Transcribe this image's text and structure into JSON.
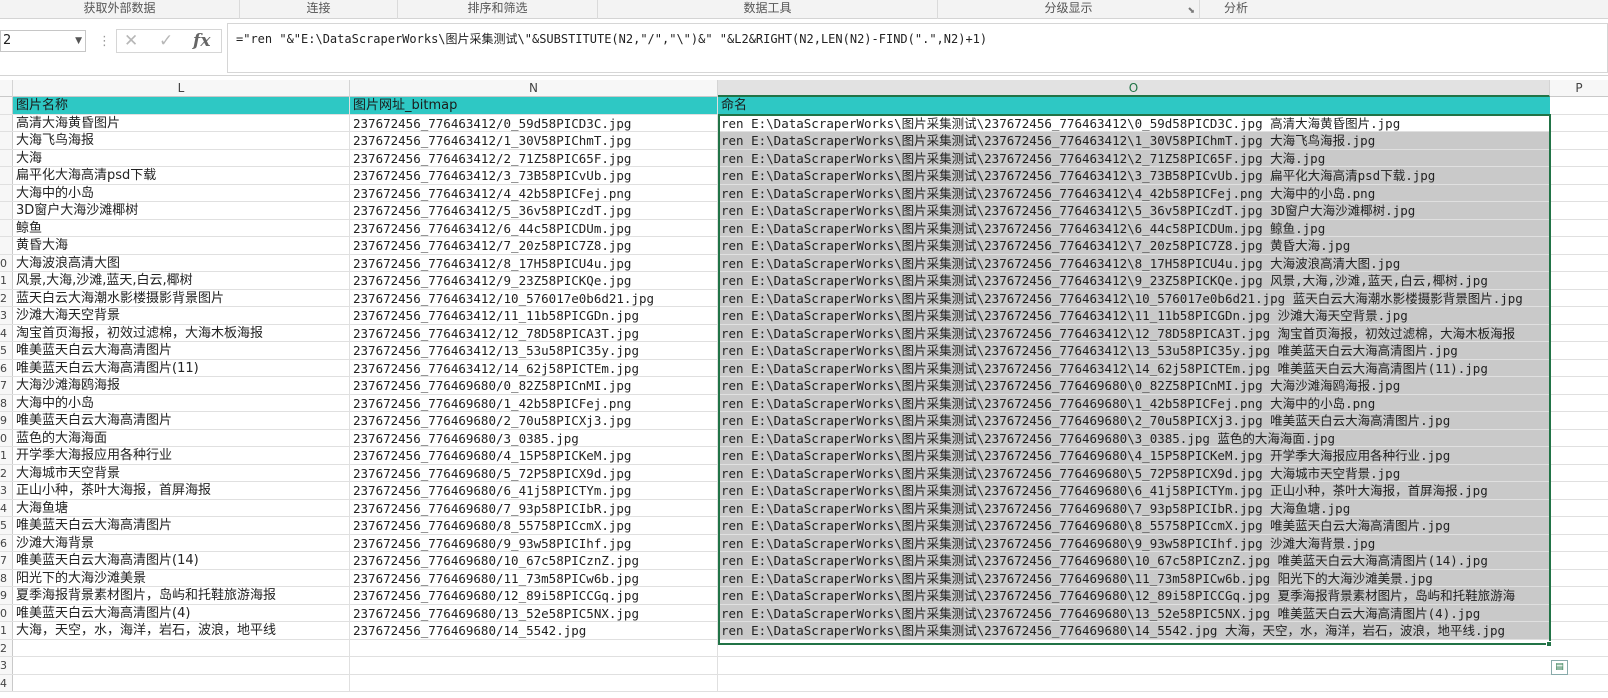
{
  "ribbon": {
    "groups": [
      {
        "label": "获取外部数据"
      },
      {
        "label": "连接"
      },
      {
        "label": "排序和筛选"
      },
      {
        "label": "数据工具"
      },
      {
        "label": "分级显示"
      },
      {
        "label": "分析"
      }
    ]
  },
  "formula_bar": {
    "name_box": "2",
    "formula": "=\"ren \"&\"E:\\DataScraperWorks\\图片采集测试\\\"&SUBSTITUTE(N2,\"/\",\"\\\")&\" \"&L2&RIGHT(N2,LEN(N2)-FIND(\".\",N2)+1)"
  },
  "columns": [
    {
      "label": "L",
      "active": false
    },
    {
      "label": "N",
      "active": false
    },
    {
      "label": "O",
      "active": true
    },
    {
      "label": "P",
      "active": false
    }
  ],
  "header_row": {
    "L": "图片名称",
    "N": "图片网址_bitmap",
    "O": "命名"
  },
  "rows": [
    {
      "num": "",
      "L": "高清大海黄昏图片",
      "N": "237672456_776463412/0_59d58PICD3C.jpg",
      "O": "ren E:\\DataScraperWorks\\图片采集测试\\237672456_776463412\\0_59d58PICD3C.jpg 高清大海黄昏图片.jpg"
    },
    {
      "num": "",
      "L": "大海飞鸟海报",
      "N": "237672456_776463412/1_30V58PIChmT.jpg",
      "O": "ren E:\\DataScraperWorks\\图片采集测试\\237672456_776463412\\1_30V58PIChmT.jpg 大海飞鸟海报.jpg"
    },
    {
      "num": "",
      "L": "大海",
      "N": "237672456_776463412/2_71Z58PIC65F.jpg",
      "O": "ren E:\\DataScraperWorks\\图片采集测试\\237672456_776463412\\2_71Z58PIC65F.jpg 大海.jpg"
    },
    {
      "num": "",
      "L": "扁平化大海高清psd下载",
      "N": "237672456_776463412/3_73B58PICvUb.jpg",
      "O": "ren E:\\DataScraperWorks\\图片采集测试\\237672456_776463412\\3_73B58PICvUb.jpg 扁平化大海高清psd下载.jpg"
    },
    {
      "num": "",
      "L": "大海中的小岛",
      "N": "237672456_776463412/4_42b58PICFej.png",
      "O": "ren E:\\DataScraperWorks\\图片采集测试\\237672456_776463412\\4_42b58PICFej.png 大海中的小岛.png"
    },
    {
      "num": "",
      "L": "3D窗户大海沙滩椰树",
      "N": "237672456_776463412/5_36v58PICzdT.jpg",
      "O": "ren E:\\DataScraperWorks\\图片采集测试\\237672456_776463412\\5_36v58PICzdT.jpg 3D窗户大海沙滩椰树.jpg"
    },
    {
      "num": "",
      "L": "鲸鱼",
      "N": "237672456_776463412/6_44c58PICDUm.jpg",
      "O": "ren E:\\DataScraperWorks\\图片采集测试\\237672456_776463412\\6_44c58PICDUm.jpg 鲸鱼.jpg"
    },
    {
      "num": "",
      "L": "黄昏大海",
      "N": "237672456_776463412/7_20z58PIC7Z8.jpg",
      "O": "ren E:\\DataScraperWorks\\图片采集测试\\237672456_776463412\\7_20z58PIC7Z8.jpg 黄昏大海.jpg"
    },
    {
      "num": "0",
      "L": "大海波浪高清大图",
      "N": "237672456_776463412/8_17H58PICU4u.jpg",
      "O": "ren E:\\DataScraperWorks\\图片采集测试\\237672456_776463412\\8_17H58PICU4u.jpg 大海波浪高清大图.jpg"
    },
    {
      "num": "1",
      "L": "风景,大海,沙滩,蓝天,白云,椰树",
      "N": "237672456_776463412/9_23Z58PICKQe.jpg",
      "O": "ren E:\\DataScraperWorks\\图片采集测试\\237672456_776463412\\9_23Z58PICKQe.jpg 风景,大海,沙滩,蓝天,白云,椰树.jpg"
    },
    {
      "num": "2",
      "L": "蓝天白云大海潮水影楼摄影背景图片",
      "N": "237672456_776463412/10_576017e0b6d21.jpg",
      "O": "ren E:\\DataScraperWorks\\图片采集测试\\237672456_776463412\\10_576017e0b6d21.jpg 蓝天白云大海潮水影楼摄影背景图片.jpg"
    },
    {
      "num": "3",
      "L": "沙滩大海天空背景",
      "N": "237672456_776463412/11_11b58PICGDn.jpg",
      "O": "ren E:\\DataScraperWorks\\图片采集测试\\237672456_776463412\\11_11b58PICGDn.jpg 沙滩大海天空背景.jpg"
    },
    {
      "num": "4",
      "L": "淘宝首页海报，初效过滤棉，大海木板海报",
      "N": "237672456_776463412/12_78D58PICA3T.jpg",
      "O": "ren E:\\DataScraperWorks\\图片采集测试\\237672456_776463412\\12_78D58PICA3T.jpg 淘宝首页海报，初效过滤棉，大海木板海报"
    },
    {
      "num": "5",
      "L": "唯美蓝天白云大海高清图片",
      "N": "237672456_776463412/13_53u58PIC35y.jpg",
      "O": "ren E:\\DataScraperWorks\\图片采集测试\\237672456_776463412\\13_53u58PIC35y.jpg 唯美蓝天白云大海高清图片.jpg"
    },
    {
      "num": "6",
      "L": "唯美蓝天白云大海高清图片(11)",
      "N": "237672456_776463412/14_62j58PICTEm.jpg",
      "O": "ren E:\\DataScraperWorks\\图片采集测试\\237672456_776463412\\14_62j58PICTEm.jpg 唯美蓝天白云大海高清图片(11).jpg"
    },
    {
      "num": "7",
      "L": "大海沙滩海鸥海报",
      "N": "237672456_776469680/0_82Z58PICnMI.jpg",
      "O": "ren E:\\DataScraperWorks\\图片采集测试\\237672456_776469680\\0_82Z58PICnMI.jpg 大海沙滩海鸥海报.jpg"
    },
    {
      "num": "8",
      "L": "大海中的小岛",
      "N": "237672456_776469680/1_42b58PICFej.png",
      "O": "ren E:\\DataScraperWorks\\图片采集测试\\237672456_776469680\\1_42b58PICFej.png 大海中的小岛.png"
    },
    {
      "num": "9",
      "L": "唯美蓝天白云大海高清图片",
      "N": "237672456_776469680/2_70u58PICXj3.jpg",
      "O": "ren E:\\DataScraperWorks\\图片采集测试\\237672456_776469680\\2_70u58PICXj3.jpg 唯美蓝天白云大海高清图片.jpg"
    },
    {
      "num": "0",
      "L": "蓝色的大海海面",
      "N": "237672456_776469680/3_0385.jpg",
      "O": "ren E:\\DataScraperWorks\\图片采集测试\\237672456_776469680\\3_0385.jpg 蓝色的大海海面.jpg"
    },
    {
      "num": "1",
      "L": "开学季大海报应用各种行业",
      "N": "237672456_776469680/4_15P58PICKeM.jpg",
      "O": "ren E:\\DataScraperWorks\\图片采集测试\\237672456_776469680\\4_15P58PICKeM.jpg 开学季大海报应用各种行业.jpg"
    },
    {
      "num": "2",
      "L": "大海城市天空背景",
      "N": "237672456_776469680/5_72P58PICX9d.jpg",
      "O": "ren E:\\DataScraperWorks\\图片采集测试\\237672456_776469680\\5_72P58PICX9d.jpg 大海城市天空背景.jpg"
    },
    {
      "num": "3",
      "L": "正山小种，茶叶大海报，首屏海报",
      "N": "237672456_776469680/6_41j58PICTYm.jpg",
      "O": "ren E:\\DataScraperWorks\\图片采集测试\\237672456_776469680\\6_41j58PICTYm.jpg 正山小种，茶叶大海报，首屏海报.jpg"
    },
    {
      "num": "4",
      "L": "大海鱼塘",
      "N": "237672456_776469680/7_93p58PICIbR.jpg",
      "O": "ren E:\\DataScraperWorks\\图片采集测试\\237672456_776469680\\7_93p58PICIbR.jpg 大海鱼塘.jpg"
    },
    {
      "num": "5",
      "L": "唯美蓝天白云大海高清图片",
      "N": "237672456_776469680/8_55758PICcmX.jpg",
      "O": "ren E:\\DataScraperWorks\\图片采集测试\\237672456_776469680\\8_55758PICcmX.jpg 唯美蓝天白云大海高清图片.jpg"
    },
    {
      "num": "6",
      "L": "沙滩大海背景",
      "N": "237672456_776469680/9_93w58PICIhf.jpg",
      "O": "ren E:\\DataScraperWorks\\图片采集测试\\237672456_776469680\\9_93w58PICIhf.jpg 沙滩大海背景.jpg"
    },
    {
      "num": "7",
      "L": "唯美蓝天白云大海高清图片(14)",
      "N": "237672456_776469680/10_67c58PICznZ.jpg",
      "O": "ren E:\\DataScraperWorks\\图片采集测试\\237672456_776469680\\10_67c58PICznZ.jpg 唯美蓝天白云大海高清图片(14).jpg"
    },
    {
      "num": "8",
      "L": "阳光下的大海沙滩美景",
      "N": "237672456_776469680/11_73m58PICw6b.jpg",
      "O": "ren E:\\DataScraperWorks\\图片采集测试\\237672456_776469680\\11_73m58PICw6b.jpg 阳光下的大海沙滩美景.jpg"
    },
    {
      "num": "9",
      "L": "夏季海报背景素材图片，岛屿和托鞋旅游海报",
      "N": "237672456_776469680/12_89i58PICCGq.jpg",
      "O": "ren E:\\DataScraperWorks\\图片采集测试\\237672456_776469680\\12_89i58PICCGq.jpg 夏季海报背景素材图片，岛屿和托鞋旅游海"
    },
    {
      "num": "0",
      "L": "唯美蓝天白云大海高清图片(4)",
      "N": "237672456_776469680/13_52e58PIC5NX.jpg",
      "O": "ren E:\\DataScraperWorks\\图片采集测试\\237672456_776469680\\13_52e58PIC5NX.jpg 唯美蓝天白云大海高清图片(4).jpg"
    },
    {
      "num": "1",
      "L": "大海，天空，水，海洋，岩石，波浪，地平线",
      "N": "237672456_776469680/14_5542.jpg",
      "O": "ren E:\\DataScraperWorks\\图片采集测试\\237672456_776469680\\14_5542.jpg 大海，天空，水，海洋，岩石，波浪，地平线.jpg"
    }
  ],
  "blank_rows": [
    "2",
    "3",
    "4"
  ],
  "colors": {
    "header_fill": "#2ec8c4",
    "selection_fill": "#c9c9c9",
    "selection_border": "#217346"
  }
}
